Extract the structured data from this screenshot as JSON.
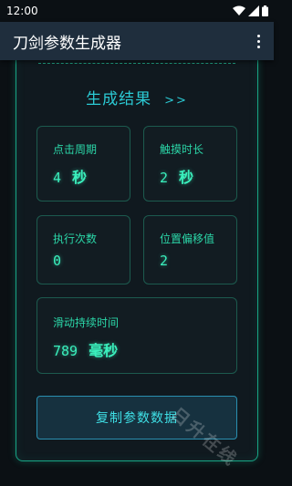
{
  "status_bar": {
    "time": "12:00"
  },
  "app_bar": {
    "title": "刀剑参数生成器"
  },
  "result": {
    "title": "生成结果",
    "arrows": ">>",
    "click_period": {
      "label": "点击周期",
      "value": "4",
      "unit": "秒"
    },
    "touch_duration": {
      "label": "触摸时长",
      "value": "2",
      "unit": "秒"
    },
    "exec_count": {
      "label": "执行次数",
      "value": "0"
    },
    "position_offset": {
      "label": "位置偏移值",
      "value": "2"
    },
    "slide_duration": {
      "label": "滑动持续时间",
      "value": "789",
      "unit": "毫秒"
    }
  },
  "copy_button": {
    "label": "复制参数数据"
  },
  "watermark": {
    "text": "日升在线"
  },
  "colors": {
    "accent": "#2bd6a8",
    "title": "#2bc9d3",
    "border": "#17a384",
    "app_bar": "#1f2e3d"
  }
}
